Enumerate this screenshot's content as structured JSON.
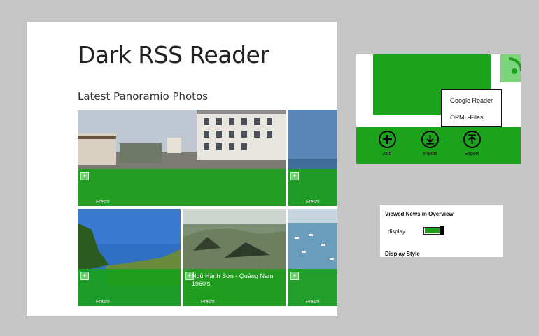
{
  "app": {
    "title": "Dark RSS Reader",
    "section_title": "Latest Panoramio Photos"
  },
  "tiles": [
    {
      "caption": "",
      "status": "Fresh!"
    },
    {
      "caption": "",
      "status": "Fresh!"
    },
    {
      "caption": "",
      "status": "Fresh!"
    },
    {
      "caption": "Ngũ Hành Sơn - Quảng Nam 1960's",
      "status": "Fresh!"
    },
    {
      "caption": "",
      "status": "Fresh!"
    }
  ],
  "appbar": {
    "flyout": [
      "Google Reader",
      "OPML-Files"
    ],
    "buttons": [
      {
        "label": "Add",
        "icon": "plus-icon"
      },
      {
        "label": "Import",
        "icon": "download-icon"
      },
      {
        "label": "Export",
        "icon": "upload-icon"
      }
    ]
  },
  "settings": {
    "heading": "Viewed News in Overview",
    "toggle_label": "display",
    "toggle_on": true,
    "subheading": "Display Style"
  },
  "colors": {
    "accent": "#1ca31c",
    "background": "#c6c6c6"
  }
}
